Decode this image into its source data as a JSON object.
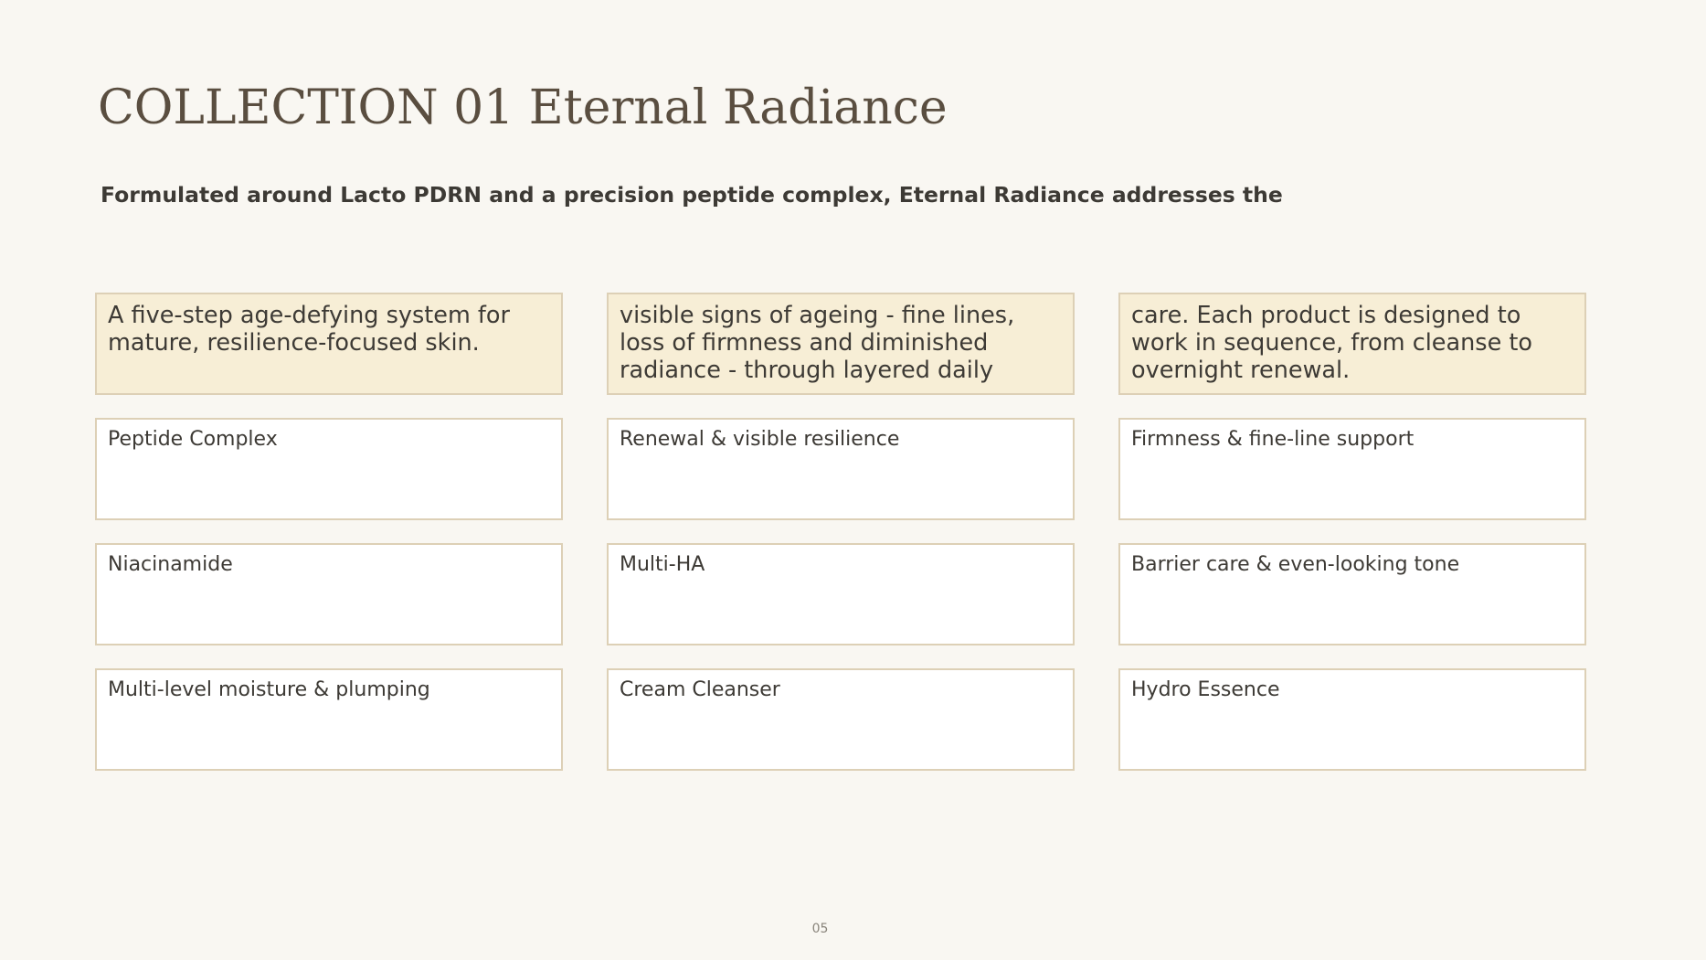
{
  "title": "COLLECTION 01 Eternal Radiance",
  "subtitle": "Formulated around Lacto PDRN and a precision peptide complex, Eternal Radiance addresses the",
  "intro_cells": [
    "A five-step age-defying system for mature, resilience-focused skin.",
    "visible signs of ageing - fine lines, loss of firmness and diminished radiance - through layered daily",
    "care. Each product is designed to work in sequence, from cleanse to overnight renewal."
  ],
  "rows": [
    [
      "Peptide Complex",
      "Renewal & visible resilience",
      "Firmness & fine-line support"
    ],
    [
      "Niacinamide",
      "Multi-HA",
      "Barrier care & even-looking tone"
    ],
    [
      "Multi-level moisture & plumping",
      "Cream Cleanser",
      "Hydro Essence"
    ]
  ],
  "page_number": "05",
  "colors": {
    "background": "#f9f7f2",
    "intro_fill": "#f7eed6",
    "cell_border": "#ddd0b6",
    "title": "#5a4e40",
    "text": "#3d3a35"
  }
}
